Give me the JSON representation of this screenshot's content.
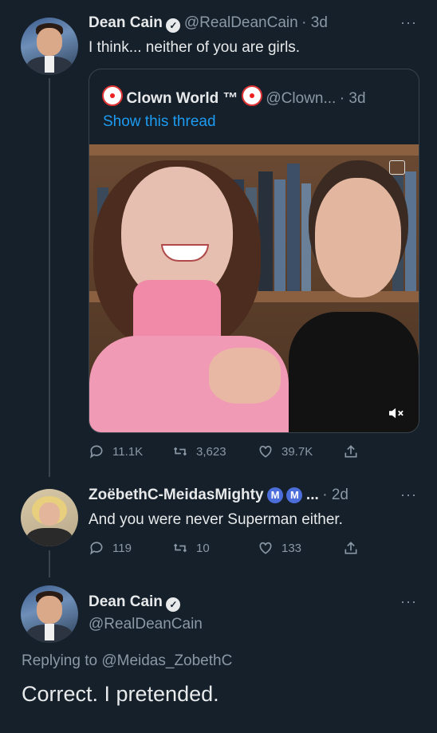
{
  "tweet1": {
    "name": "Dean Cain",
    "handle": "@RealDeanCain",
    "time": "· 3d",
    "text": "I think... neither of you are girls.",
    "more": "···",
    "quote": {
      "name": "Clown World ™",
      "handle": "@Clown...",
      "time": "· 3d",
      "show_thread": "Show this thread"
    },
    "actions": {
      "replies": "11.1K",
      "retweets": "3,623",
      "likes": "39.7K"
    }
  },
  "tweet2": {
    "name": "ZoëbethC-MeidasMighty",
    "badge1": "M",
    "badge2": "M",
    "ellipsis": "...",
    "time": "· 2d",
    "text": "And you were never Superman either.",
    "more": "···",
    "actions": {
      "replies": "119",
      "retweets": "10",
      "likes": "133"
    }
  },
  "tweet3": {
    "name": "Dean Cain",
    "handle": "@RealDeanCain",
    "more": "···",
    "replying_to": "Replying to @Meidas_ZobethC",
    "text": "Correct. I pretended."
  },
  "icons": {
    "reply": "reply-icon",
    "retweet": "retweet-icon",
    "like": "heart-icon",
    "share": "share-icon",
    "verified": "verified-badge-icon",
    "mute": "volume-mute-icon"
  },
  "colors": {
    "background": "#15202b",
    "link": "#1d9bf0",
    "muted": "#8b98a5"
  }
}
